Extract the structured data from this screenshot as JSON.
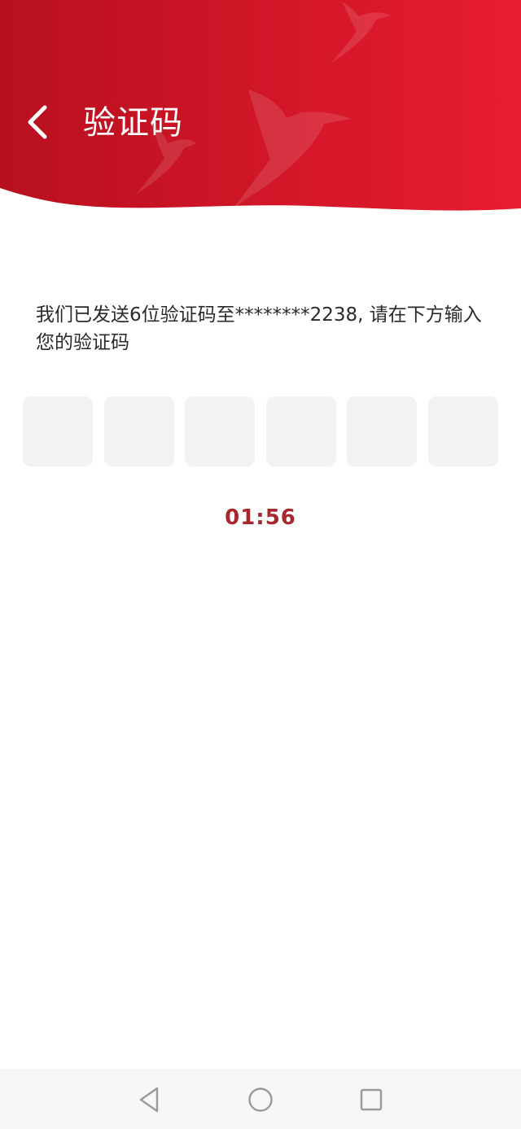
{
  "header": {
    "title": "验证码",
    "back_icon": "chevron-left-icon",
    "bird_icon": "bird-watermark-icon",
    "colors": {
      "gradient_start": "#b8101f",
      "gradient_end": "#e81c30",
      "text": "#ffffff"
    }
  },
  "message": {
    "text": "我们已发送6位验证码至********2238, 请在下方输入您的验证码"
  },
  "code_inputs": {
    "count": 6,
    "values": [
      "",
      "",
      "",
      "",
      "",
      ""
    ],
    "box_color": "#f2f2f2"
  },
  "timer": {
    "text": "01:56",
    "color": "#a8262d"
  },
  "navbar": {
    "back_icon": "triangle-back-icon",
    "home_icon": "circle-home-icon",
    "recents_icon": "square-recents-icon",
    "background": "#f7f7f7"
  }
}
